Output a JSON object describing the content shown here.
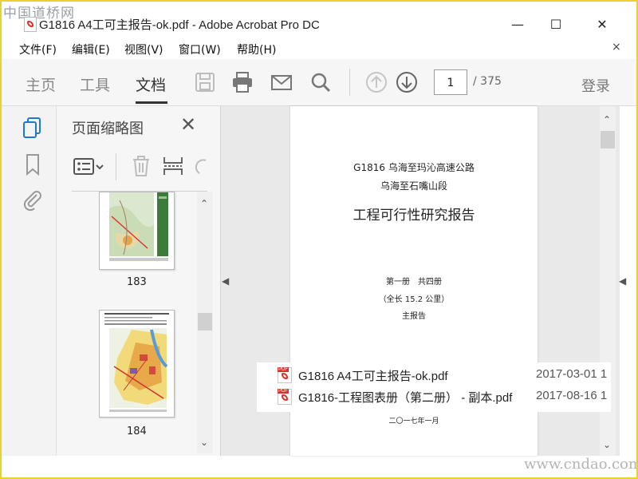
{
  "watermark_top": "中国道桥网",
  "watermark_bottom": "www.cndao.com",
  "window": {
    "title": "G1816   A4工可主报告-ok.pdf - Adobe Acrobat Pro DC",
    "minimize": "—",
    "maximize": "☐",
    "close": "✕"
  },
  "menu": {
    "items": [
      "文件(F)",
      "编辑(E)",
      "视图(V)",
      "窗口(W)",
      "帮助(H)"
    ],
    "close": "×"
  },
  "toolbar": {
    "tabs": [
      "主页",
      "工具",
      "文档"
    ],
    "active_tab": "文档",
    "page_current": "1",
    "page_total": "/ 375",
    "login": "登录",
    "icons": [
      "save-icon",
      "print-icon",
      "email-icon",
      "search-icon",
      "page-up-icon",
      "page-down-icon"
    ]
  },
  "thumbnails": {
    "title": "页面缩略图",
    "close": "✕",
    "pages": [
      "183",
      "184"
    ]
  },
  "document": {
    "line1": "G1816 乌海至玛沁高速公路",
    "line2": "乌海至石嘴山段",
    "heading": "工程可行性研究报告",
    "volume": "第一册　共四册",
    "length": "（全长 15.2 公里）",
    "report_type": "主报告",
    "date": "二〇一七年一月"
  },
  "recent_files": [
    {
      "name": "G1816   A4工可主报告-ok.pdf",
      "date": "2017-03-01 1"
    },
    {
      "name": "G1816-工程图表册（第二册） - 副本.pdf",
      "date": "2017-08-16 1"
    }
  ]
}
